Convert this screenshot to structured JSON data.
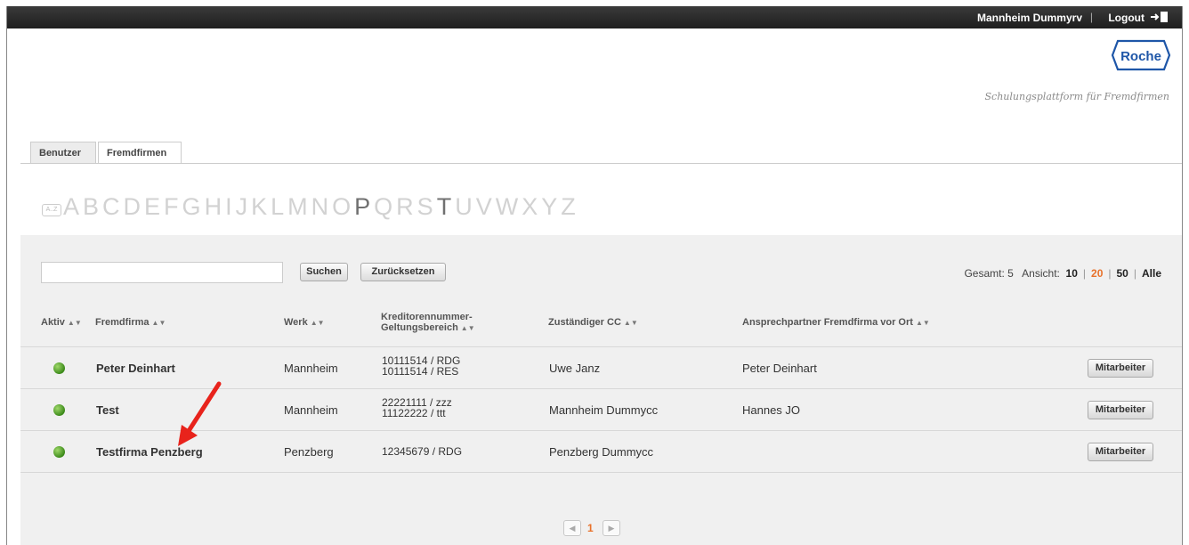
{
  "topbar": {
    "user_name": "Mannheim Dummyrv",
    "separator": "|",
    "logout_label": "Logout"
  },
  "brand": {
    "logo_text": "Roche",
    "tagline": "Schulungsplattform für Fremdfirmen",
    "logo_color": "#1e56a8"
  },
  "tabs": [
    {
      "label": "Benutzer",
      "active": false
    },
    {
      "label": "Fremdfirmen",
      "active": true
    }
  ],
  "alphabet": {
    "az_icon_label": "A..Z",
    "letters": [
      "A",
      "B",
      "C",
      "D",
      "E",
      "F",
      "G",
      "H",
      "I",
      "J",
      "K",
      "L",
      "M",
      "N",
      "O",
      "P",
      "Q",
      "R",
      "S",
      "T",
      "U",
      "V",
      "W",
      "X",
      "Y",
      "Z"
    ],
    "active_letters": [
      "P",
      "T"
    ]
  },
  "search": {
    "value": "",
    "search_button": "Suchen",
    "reset_button": "Zurücksetzen"
  },
  "pager_info": {
    "total_label": "Gesamt: 5",
    "view_label": "Ansicht:",
    "options": [
      "10",
      "20",
      "50",
      "Alle"
    ],
    "current": "20"
  },
  "table": {
    "headers": {
      "aktiv": "Aktiv",
      "fremdfirma": "Fremdfirma",
      "werk": "Werk",
      "kred_line1": "Kreditorennummer-",
      "kred_line2": "Geltungsbereich",
      "cc": "Zuständiger CC",
      "ansprech": "Ansprechpartner Fremdfirma vor Ort"
    },
    "action_label": "Mitarbeiter",
    "rows": [
      {
        "fremdfirma": "Peter Deinhart",
        "werk": "Mannheim",
        "kred1": "10111514 / RDG",
        "kred2": "10111514 / RES",
        "cc": "Uwe Janz",
        "ansprech": "Peter Deinhart"
      },
      {
        "fremdfirma": "Test",
        "werk": "Mannheim",
        "kred1": "22221111 / zzz",
        "kred2": "11122222 / ttt",
        "cc": "Mannheim Dummycc",
        "ansprech": "Hannes JO"
      },
      {
        "fremdfirma": "Testfirma Penzberg",
        "werk": "Penzberg",
        "kred1": "12345679 / RDG",
        "kred2": "",
        "cc": "Penzberg Dummycc",
        "ansprech": ""
      }
    ]
  },
  "pagination": {
    "current_page": "1"
  },
  "annotation": {
    "arrow_color": "#e8231c"
  }
}
